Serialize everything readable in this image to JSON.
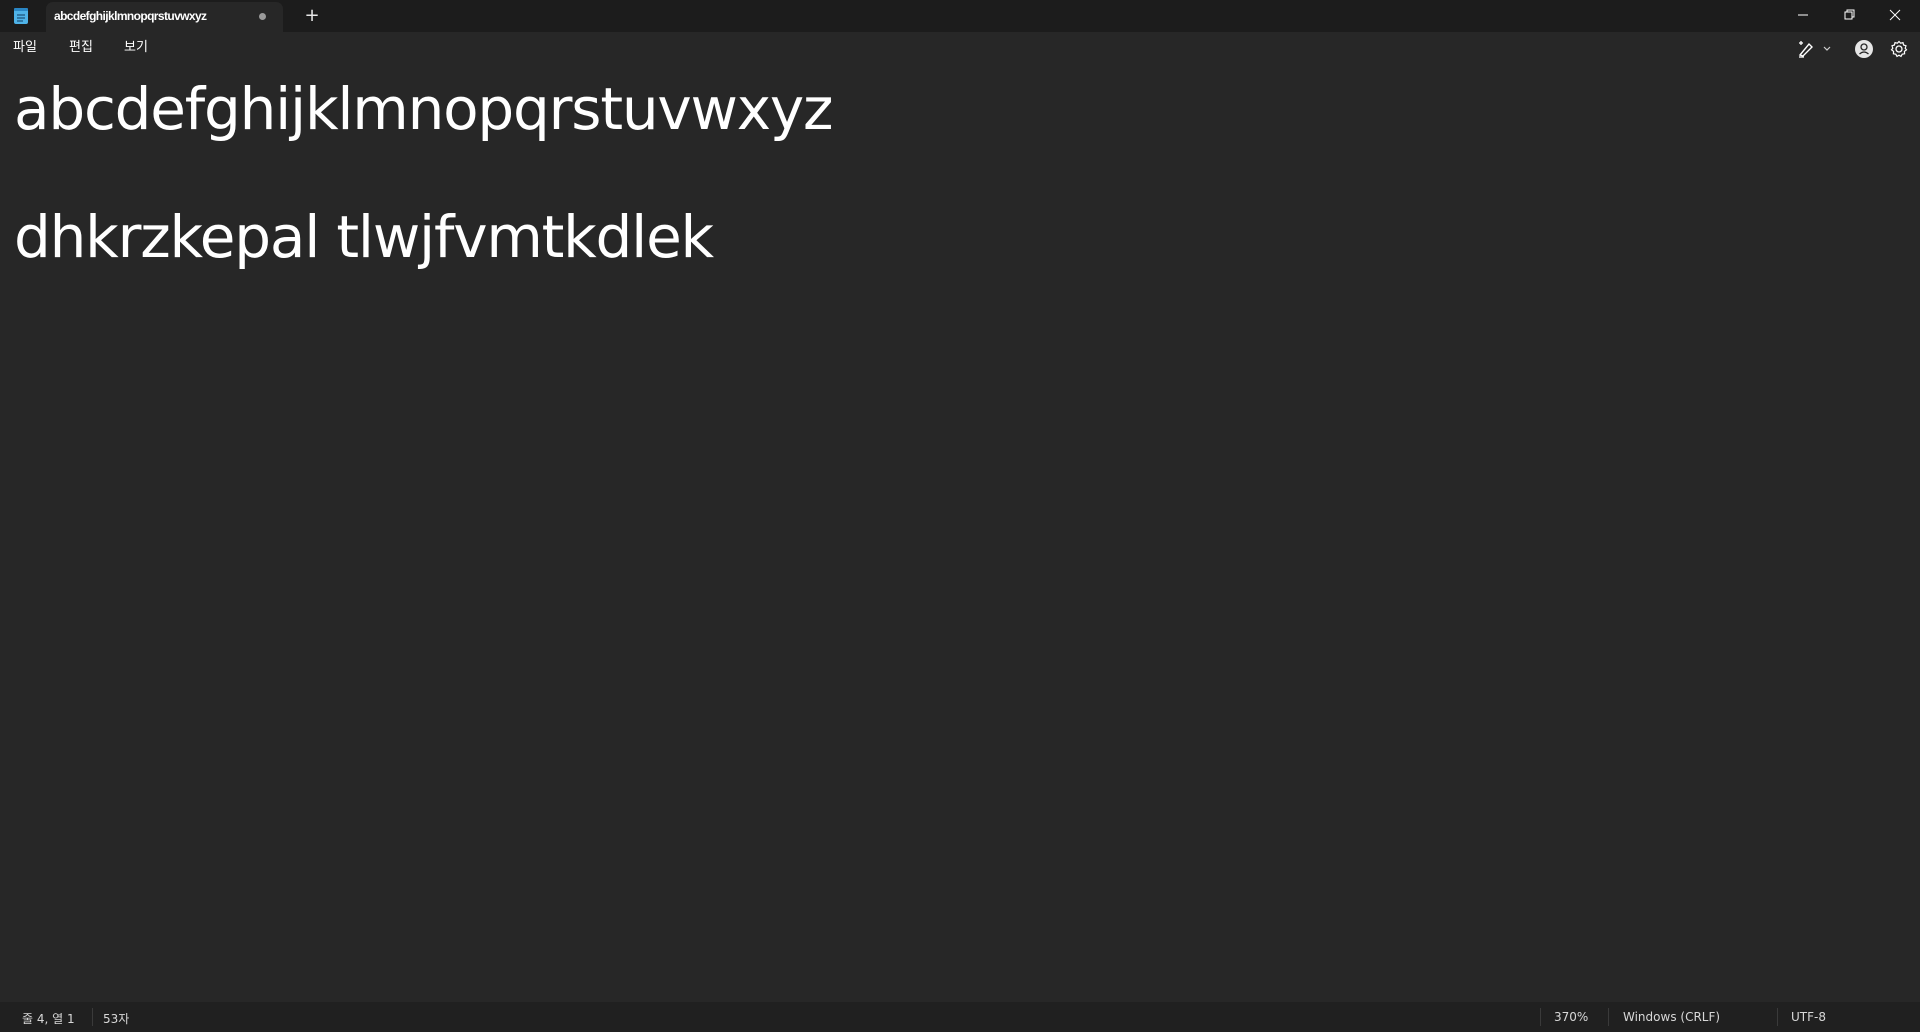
{
  "tab": {
    "title": "abcdefghijklmnopqrstuvwxyz",
    "new_tab_label": "+"
  },
  "menu": {
    "file": "파일",
    "edit": "편집",
    "view": "보기"
  },
  "editor": {
    "lines": [
      "abcdefghijklmnopqrstuvwxyz",
      "",
      "dhkrzkepal tlwjfvmtkdlek",
      ""
    ]
  },
  "status": {
    "position": "줄 4, 열 1",
    "char_count": "53자",
    "zoom": "370%",
    "line_ending": "Windows (CRLF)",
    "encoding": "UTF-8"
  },
  "colors": {
    "titlebar_bg": "#1c1c1c",
    "editor_bg": "#272727",
    "statusbar_bg": "#202020",
    "app_icon": "#4fb3e8"
  },
  "icons": {
    "app": "notepad-icon",
    "tab_unsaved": "unsaved-dot-icon",
    "minimize": "minimize-icon",
    "maximize": "restore-icon",
    "close": "close-icon",
    "copilot": "copilot-pen-icon",
    "dropdown": "chevron-down-icon",
    "account": "account-icon",
    "settings": "gear-icon"
  }
}
